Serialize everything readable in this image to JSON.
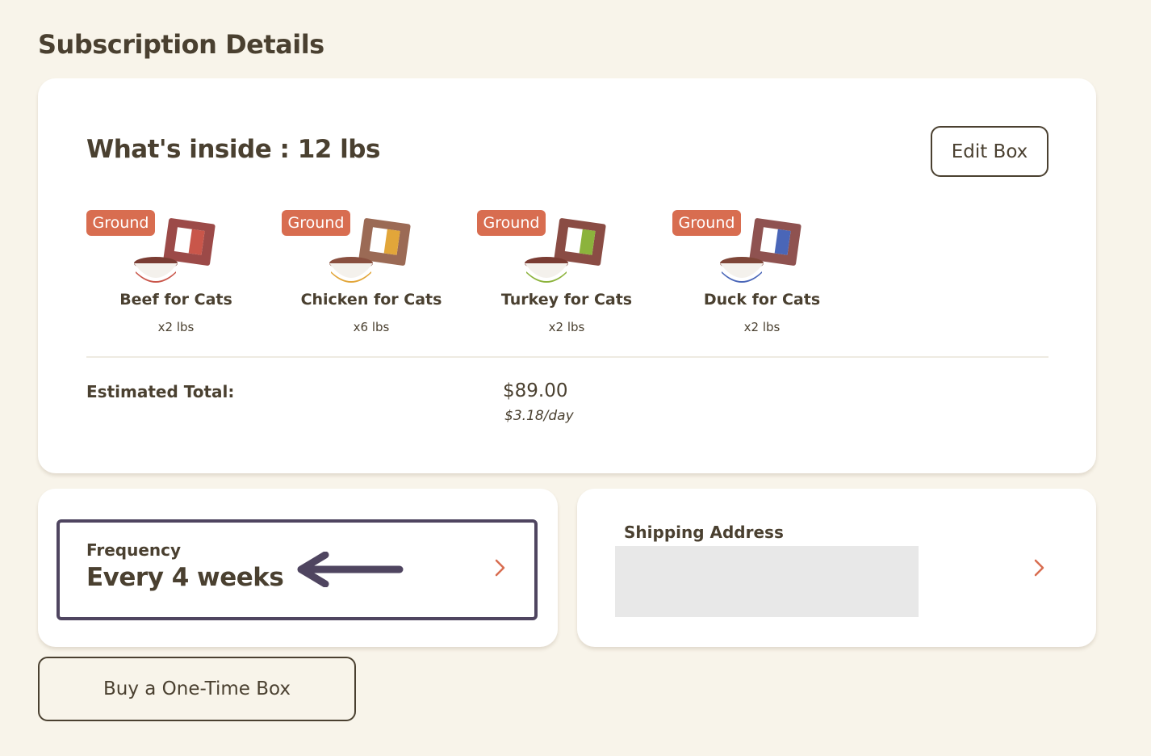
{
  "page": {
    "title": "Subscription Details"
  },
  "box": {
    "title": "What's inside : 12 lbs",
    "edit_label": "Edit Box",
    "items": [
      {
        "badge": "Ground",
        "name": "Beef for Cats",
        "qty": "x2 lbs",
        "color": "#c9564a"
      },
      {
        "badge": "Ground",
        "name": "Chicken for Cats",
        "qty": "x6 lbs",
        "color": "#e2a63a"
      },
      {
        "badge": "Ground",
        "name": "Turkey for Cats",
        "qty": "x2 lbs",
        "color": "#8cb33c"
      },
      {
        "badge": "Ground",
        "name": "Duck for Cats",
        "qty": "x2 lbs",
        "color": "#4a66b8"
      }
    ],
    "total_label": "Estimated Total:",
    "total_price": "$89.00",
    "total_per_day": "$3.18/day"
  },
  "frequency": {
    "label": "Frequency",
    "value": "Every 4 weeks"
  },
  "shipping": {
    "label": "Shipping Address"
  },
  "actions": {
    "one_time_label": "Buy a One-Time Box"
  },
  "colors": {
    "background": "#f8f4ea",
    "accent": "#d86d50",
    "text": "#4a4030",
    "highlight": "#4f4560"
  },
  "icons": {
    "chevron": "chevron-right-icon",
    "arrow": "arrow-left-icon"
  }
}
